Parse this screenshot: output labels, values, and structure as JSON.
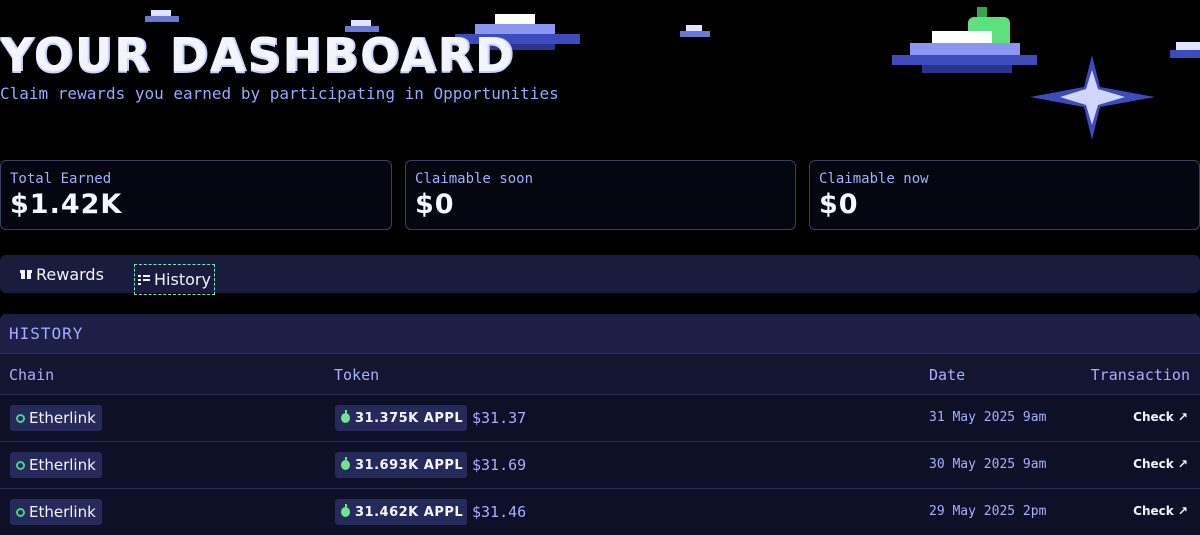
{
  "header": {
    "title": "YOUR DASHBOARD",
    "subtitle": "Claim rewards you earned by participating in Opportunities"
  },
  "stats": [
    {
      "label": "Total Earned",
      "value": "$1.42K"
    },
    {
      "label": "Claimable soon",
      "value": "$0"
    },
    {
      "label": "Claimable now",
      "value": "$0"
    }
  ],
  "tabs": [
    {
      "label": "Rewards",
      "icon": "gift-icon",
      "active": false
    },
    {
      "label": "History",
      "icon": "list-icon",
      "active": true
    }
  ],
  "history": {
    "title": "HISTORY",
    "columns": [
      "Chain",
      "Token",
      "Date",
      "Transaction"
    ],
    "rows": [
      {
        "chain": "Etherlink",
        "token_amount": "31.375K APPL",
        "usd": "$31.37",
        "date": "31 May 2025 9am",
        "action": "Check ↗"
      },
      {
        "chain": "Etherlink",
        "token_amount": "31.693K APPL",
        "usd": "$31.69",
        "date": "30 May 2025 9am",
        "action": "Check ↗"
      },
      {
        "chain": "Etherlink",
        "token_amount": "31.462K APPL",
        "usd": "$31.46",
        "date": "29 May 2025 2pm",
        "action": "Check ↗"
      }
    ]
  },
  "colors": {
    "background": "#000000",
    "accent": "#a6aeff",
    "panel": "#131531",
    "active_tab_outline": "#7fe6b4",
    "token_icon": "#6ee58e"
  }
}
